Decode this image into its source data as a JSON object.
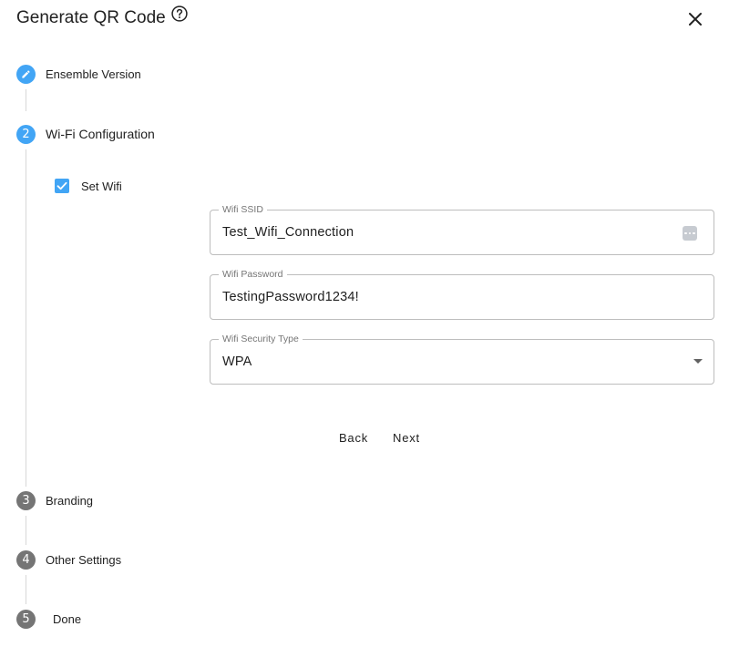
{
  "dialog": {
    "title": "Generate QR Code"
  },
  "stepper": {
    "steps": [
      {
        "number": "1",
        "label": "Ensemble Version",
        "state": "completed",
        "icon": "pencil-icon"
      },
      {
        "number": "2",
        "label": "Wi-Fi Configuration",
        "state": "active"
      },
      {
        "number": "3",
        "label": "Branding",
        "state": "inactive"
      },
      {
        "number": "4",
        "label": "Other Settings",
        "state": "inactive"
      },
      {
        "number": "5",
        "label": "Done",
        "state": "inactive"
      }
    ]
  },
  "wifi": {
    "set_wifi": {
      "label": "Set Wifi",
      "checked": true
    },
    "ssid": {
      "label": "Wifi SSID",
      "value": "Test_Wifi_Connection",
      "adornment_icon": "more-horiz-icon"
    },
    "password": {
      "label": "Wifi Password",
      "value": "TestingPassword1234!"
    },
    "security_type": {
      "label": "Wifi Security Type",
      "value": "WPA"
    }
  },
  "actions": {
    "back_label": "Back",
    "next_label": "Next"
  },
  "colors": {
    "active_step": "#42a5f5",
    "inactive_step": "#757575",
    "checkbox": "#42a5f5",
    "field_border": "#bdbdbd"
  }
}
